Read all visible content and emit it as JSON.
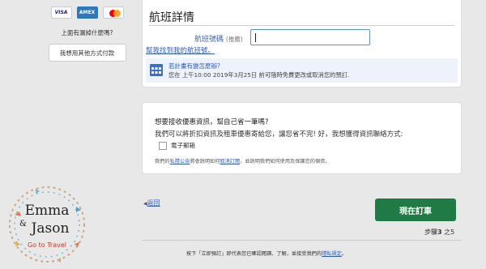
{
  "payment": {
    "cards": [
      "VISA",
      "AMEX",
      "mastercard"
    ],
    "missing_question": "上面有漏掉什麼嗎?",
    "other_pay_button": "我想用其他方式付款"
  },
  "flight": {
    "title": "航班詳情",
    "number_label": "航班號碼",
    "number_optional": "(推薦)",
    "number_value": "",
    "help_link": "幫我找到我的航班號。",
    "notice_title": "若計畫有變怎麼辦?",
    "notice_text": "您在 上午10:00 2019年3月25日 前可隨時免費更改或取消您的預訂."
  },
  "offers": {
    "question": "想要接收優惠資訊，幫自己省一筆嗎?",
    "subtext": "我們可以將折扣資訊及租車優惠寄給您，讓您省不完! 好，我想獲得資訊聯絡方式:",
    "email_option": "電子郵箱",
    "privacy_pre": "我們的",
    "privacy_link": "私隱公告",
    "privacy_mid": "將會說明如何",
    "unsubscribe_link": "取消訂閱",
    "privacy_post": "，並說明我們如何使用及保護您的個資。"
  },
  "nav": {
    "back_label": "返回",
    "book_button": "現在訂車",
    "step_pre": "步驟",
    "step_current": "3",
    "step_mid": " 之",
    "step_total": "5"
  },
  "terms": {
    "text": "按下「立即預訂」即代表您已確認閱讀、了解，並接受我們的",
    "link": "隱私規定",
    "end": "。"
  },
  "logo": {
    "line1": "Emma",
    "amp": "&",
    "line2": "Jason",
    "tagline": "Go to Travel"
  },
  "colors": {
    "accent": "#2f5bb5",
    "book": "#1f7a45"
  }
}
